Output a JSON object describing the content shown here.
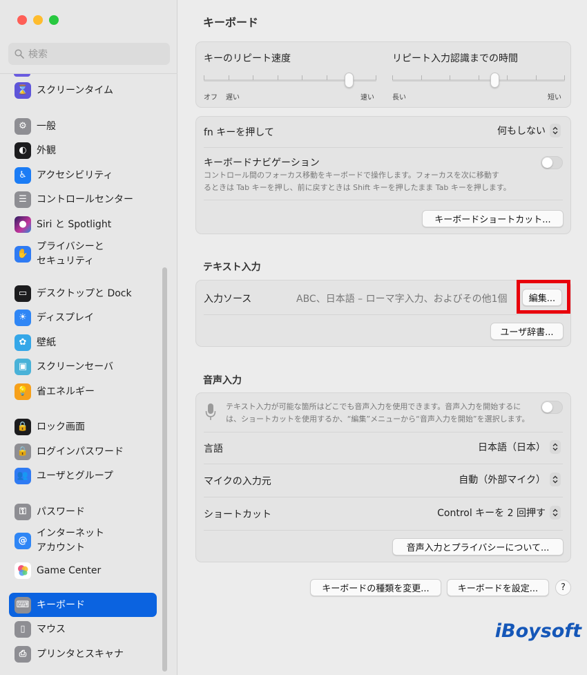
{
  "sidebar": {
    "traffic_colors": [
      "#fe5f57",
      "#febc2e",
      "#28c840"
    ],
    "search_placeholder": "検索",
    "items": [
      {
        "label": "スクリーンタイム",
        "icon": "hourglass-icon",
        "color": "#5e55d9"
      },
      {
        "label": "一般",
        "icon": "gear-icon",
        "color": "#8e8e93"
      },
      {
        "label": "外観",
        "icon": "appearance-icon",
        "color": "#1c1c1e"
      },
      {
        "label": "アクセシビリティ",
        "icon": "accessibility-icon",
        "color": "#1b7cf5"
      },
      {
        "label": "コントロールセンター",
        "icon": "control-center-icon",
        "color": "#8e8e93"
      },
      {
        "label": "Siri と Spotlight",
        "icon": "siri-icon",
        "color": "#3a2f8f"
      },
      {
        "label": "プライバシーと",
        "label2": "セキュリティ",
        "icon": "hand-icon",
        "color": "#2f7bf3"
      },
      {
        "label": "デスクトップと Dock",
        "icon": "dock-icon",
        "color": "#1c1c1e"
      },
      {
        "label": "ディスプレイ",
        "icon": "sun-icon",
        "color": "#2f86f5"
      },
      {
        "label": "壁紙",
        "icon": "wallpaper-icon",
        "color": "#35a7e8"
      },
      {
        "label": "スクリーンセーバ",
        "icon": "screensaver-icon",
        "color": "#49b2d8"
      },
      {
        "label": "省エネルギー",
        "icon": "bulb-icon",
        "color": "#f6a01a"
      },
      {
        "label": "ロック画面",
        "icon": "lock-icon",
        "color": "#1c1c1e"
      },
      {
        "label": "ログインパスワード",
        "icon": "lock-outline-icon",
        "color": "#8e8e93"
      },
      {
        "label": "ユーザとグループ",
        "icon": "users-icon",
        "color": "#2f7bf3"
      },
      {
        "label": "パスワード",
        "icon": "key-icon",
        "color": "#8e8e93"
      },
      {
        "label": "インターネット",
        "label2": "アカウント",
        "icon": "at-icon",
        "color": "#2f86f5"
      },
      {
        "label": "Game Center",
        "icon": "game-center-icon",
        "color": "#ffffff"
      },
      {
        "label": "キーボード",
        "icon": "keyboard-icon",
        "color": "#8e8e93",
        "active": true
      },
      {
        "label": "マウス",
        "icon": "mouse-icon",
        "color": "#8e8e93"
      },
      {
        "label": "プリンタとスキャナ",
        "icon": "printer-icon",
        "color": "#8e8e93"
      }
    ]
  },
  "main": {
    "title": "キーボード",
    "repeat_rate": {
      "label": "キーのリピート速度",
      "min_label": "オフ",
      "low_label": "遅い",
      "max_label": "速い",
      "value": 0.86
    },
    "repeat_delay": {
      "label": "リピート入力認識までの時間",
      "min_label": "長い",
      "max_label": "短い",
      "value": 0.6
    },
    "fn": {
      "label": "fn キーを押して",
      "value": "何もしない"
    },
    "nav": {
      "label": "キーボードナビゲーション",
      "desc1": "コントロール間のフォーカス移動をキーボードで操作します。フォーカスを次に移動す",
      "desc2": "るときは Tab キーを押し、前に戻すときは Shift キーを押したまま Tab キーを押します。",
      "enabled": false
    },
    "shortcuts_button": "キーボードショートカット...",
    "text_input": {
      "title": "テキスト入力",
      "source_label": "入力ソース",
      "source_value": "ABC、日本語 – ローマ字入力、およびその他1個",
      "edit_button": "編集...",
      "dict_button": "ユーザ辞書..."
    },
    "dictation": {
      "title": "音声入力",
      "desc1": "テキスト入力が可能な箇所はどこでも音声入力を使用できます。音声入力を開始するに",
      "desc2": "は、ショートカットを使用するか、“編集”メニューから“音声入力を開始”を選択します。",
      "enabled": false,
      "lang_label": "言語",
      "lang_value": "日本語（日本）",
      "mic_label": "マイクの入力元",
      "mic_value": "自動（外部マイク）",
      "shortcut_label": "ショートカット",
      "shortcut_value": "Control キーを 2 回押す",
      "privacy_button": "音声入力とプライバシーについて..."
    },
    "change_type_button": "キーボードの種類を変更...",
    "setup_button": "キーボードを設定...",
    "help": "?",
    "highlight_color": "#e8000b"
  },
  "watermark": "iBoysoft"
}
